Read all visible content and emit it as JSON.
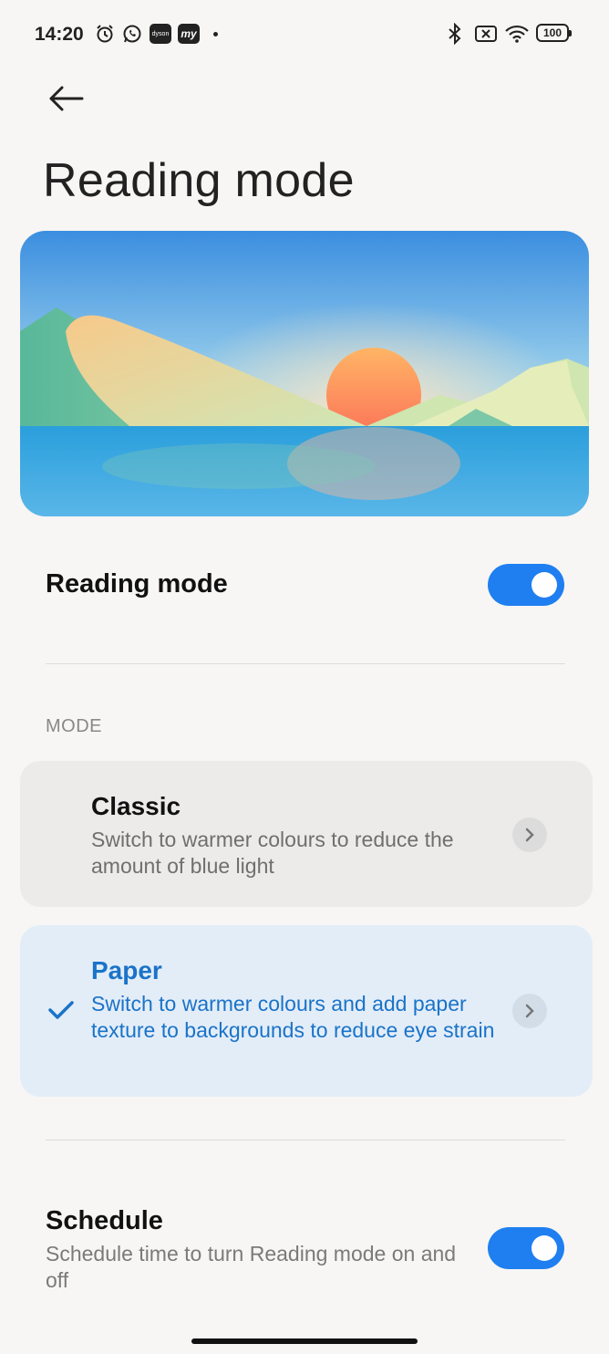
{
  "status_bar": {
    "time": "14:20",
    "app_icons": [
      "alarm-icon",
      "whatsapp-icon",
      "dyson-icon",
      "my-app-icon"
    ],
    "dyson_text": "dyson",
    "my_text": "my",
    "right_icons": [
      "bluetooth-icon",
      "sim-icon",
      "wifi-icon",
      "battery-icon"
    ],
    "battery": "100"
  },
  "header": {
    "title": "Reading mode"
  },
  "reading_mode": {
    "label": "Reading mode",
    "enabled": true
  },
  "mode_section": {
    "heading": "MODE",
    "options": [
      {
        "title": "Classic",
        "description": "Switch to warmer colours to reduce the amount of blue light",
        "selected": false
      },
      {
        "title": "Paper",
        "description": "Switch to warmer colours and add paper texture to backgrounds to reduce eye strain",
        "selected": true
      }
    ]
  },
  "schedule": {
    "label": "Schedule",
    "description": "Schedule time to turn Reading mode on and off",
    "enabled": true
  },
  "colors": {
    "accent": "#1f7ff0",
    "selected_text": "#1a73c8",
    "selected_card": "#e3edf8"
  }
}
